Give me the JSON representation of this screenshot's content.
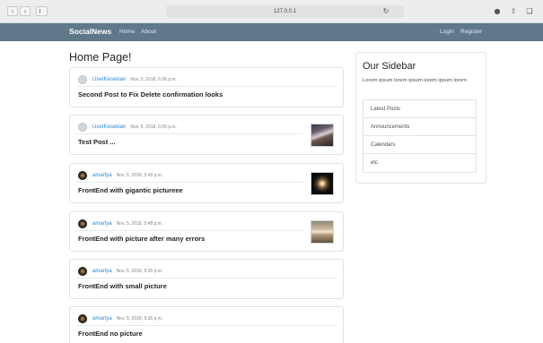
{
  "browser": {
    "address": "127.0.0.1",
    "back_icon": "chevron-left-icon",
    "forward_icon": "chevron-right-icon"
  },
  "navbar": {
    "brand": "SocialNews",
    "links": [
      "Home",
      "About"
    ],
    "right_links": [
      "Login",
      "Register"
    ],
    "bg_color": "#5f788a"
  },
  "main": {
    "title": "Home Page!"
  },
  "posts": [
    {
      "author": "UserKesekian",
      "date": "Nov. 5, 2018, 6:36 p.m.",
      "title": "Second Post to Fix Delete confirmation looks"
    },
    {
      "author": "UserKesekian",
      "date": "Nov. 5, 2018, 6:09 p.m.",
      "title": "Test Post ..."
    },
    {
      "author": "amartya",
      "date": "Nov. 5, 2018, 5:49 p.m.",
      "title": "FrontEnd with gigantic pictureee"
    },
    {
      "author": "amartya",
      "date": "Nov. 5, 2018, 5:48 p.m.",
      "title": "FrontEnd with picture after many errors"
    },
    {
      "author": "amartya",
      "date": "Nov. 5, 2018, 5:35 p.m.",
      "title": "FrontEnd with small picture"
    },
    {
      "author": "amartya",
      "date": "Nov. 5, 2018, 5:35 p.m.",
      "title": "FrontEnd no picture"
    }
  ],
  "sidebar": {
    "title": "Our Sidebar",
    "text": "Lorem ipsum lorem ipsum lorem ipsum lorem",
    "items": [
      "Latest Posts",
      "Announcements",
      "Calendars",
      "etc"
    ]
  }
}
